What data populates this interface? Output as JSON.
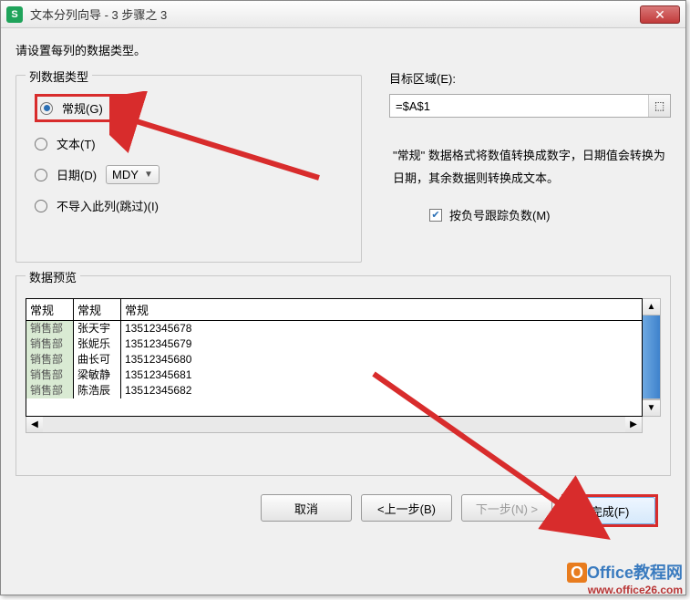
{
  "titlebar": {
    "app_icon_letter": "S",
    "title": "文本分列向导 - 3 步骤之 3"
  },
  "instruction": "请设置每列的数据类型。",
  "col_type": {
    "legend": "列数据类型",
    "general": "常规(G)",
    "text": "文本(T)",
    "date": "日期(D)",
    "date_format": "MDY",
    "skip": "不导入此列(跳过)(I)"
  },
  "target": {
    "label": "目标区域(E):",
    "value": "=$A$1"
  },
  "description": "\"常规\" 数据格式将数值转换成数字，日期值会转换为日期，其余数据则转换成文本。",
  "negatives": {
    "label": "按负号跟踪负数(M)"
  },
  "preview": {
    "legend": "数据预览",
    "headers": [
      "常规",
      "常规",
      "常规"
    ],
    "rows": [
      [
        "销售部",
        "张天宇",
        "13512345678"
      ],
      [
        "销售部",
        "张妮乐",
        "13512345679"
      ],
      [
        "销售部",
        "曲长可",
        "13512345680"
      ],
      [
        "销售部",
        "梁敏静",
        "13512345681"
      ],
      [
        "销售部",
        "陈浩辰",
        "13512345682"
      ]
    ]
  },
  "buttons": {
    "cancel": "取消",
    "back": "<上一步(B)",
    "next": "下一步(N) >",
    "finish": "完成(F)"
  },
  "watermark": {
    "brand": "Office教程网",
    "url": "www.office26.com"
  }
}
